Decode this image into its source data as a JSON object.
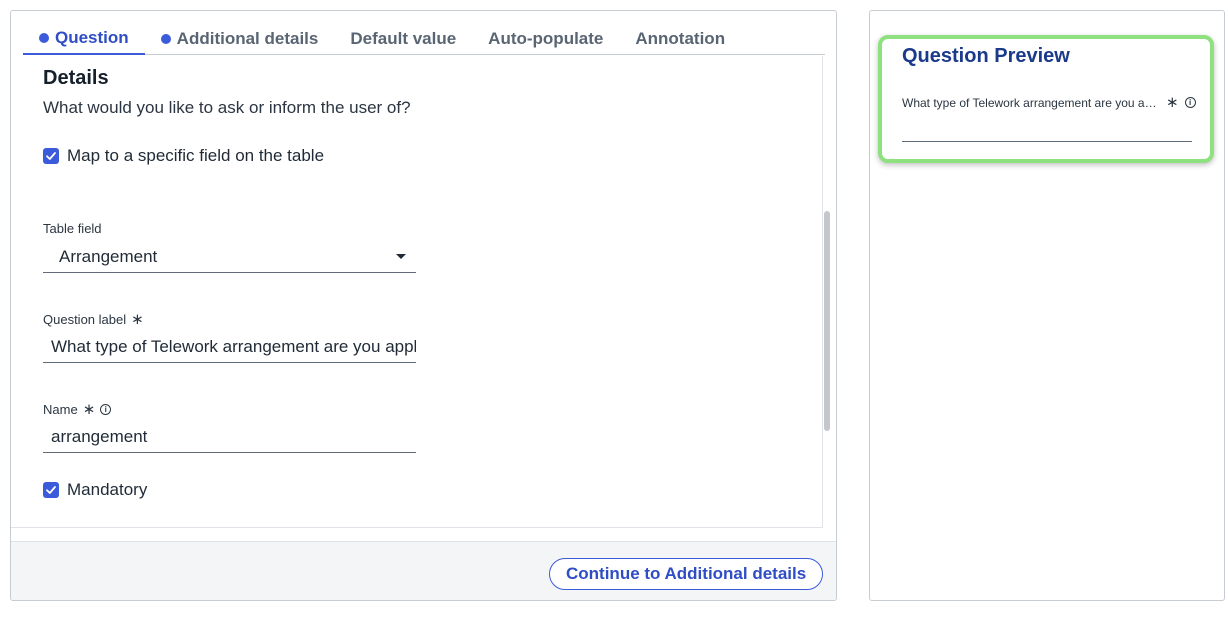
{
  "tabs": [
    {
      "label": "Question",
      "dot": true,
      "active": true
    },
    {
      "label": "Additional details",
      "dot": true
    },
    {
      "label": "Default value"
    },
    {
      "label": "Auto-populate"
    },
    {
      "label": "Annotation"
    }
  ],
  "details": {
    "heading": "Details",
    "subtitle": "What would you like to ask or inform the user of?",
    "map_checkbox_label": "Map to a specific field on the table",
    "map_checked": true,
    "table_field": {
      "label": "Table field",
      "value": "Arrangement"
    },
    "question_label": {
      "label": "Question label",
      "required_mark": "∗",
      "value": "What type of Telework arrangement are you applying for?"
    },
    "name": {
      "label": "Name",
      "required_mark": "∗",
      "value": "arrangement"
    },
    "mandatory_label": "Mandatory",
    "mandatory_checked": true
  },
  "footer": {
    "continue_label": "Continue to Additional details"
  },
  "preview": {
    "title": "Question Preview",
    "question_text": "What type of Telework arrangement are you applying for?",
    "required_mark": "∗",
    "input_value": ""
  },
  "colors": {
    "accent": "#3b5bdb",
    "preview_title": "#1c3a8c",
    "highlight": "#8fe07f"
  },
  "icons": [
    "checkmark-icon",
    "chevron-down-icon",
    "info-icon",
    "required-asterisk-icon"
  ]
}
